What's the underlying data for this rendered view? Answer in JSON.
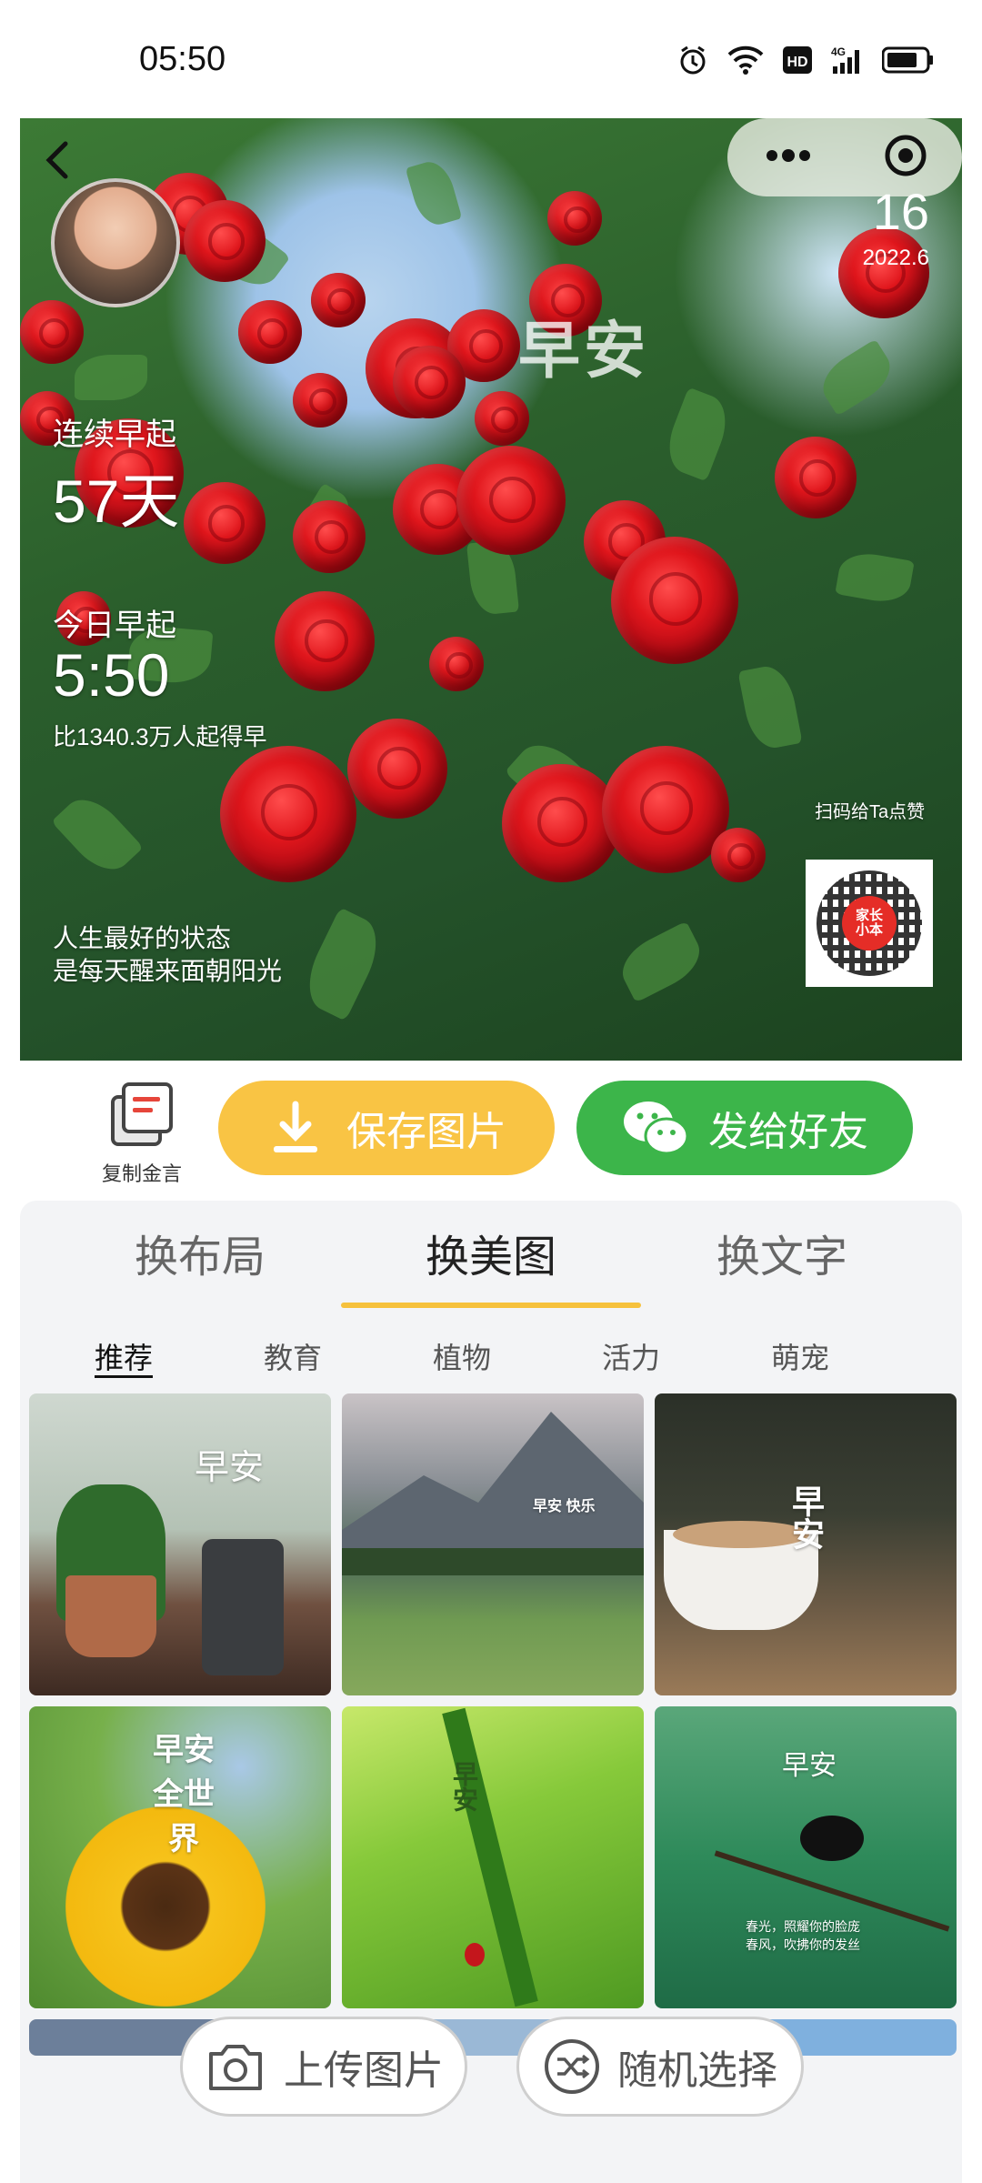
{
  "status_bar": {
    "time": "05:50",
    "icons": [
      "alarm-icon",
      "wifi-icon",
      "hd-icon",
      "4g-signal-icon",
      "battery-icon"
    ]
  },
  "hero": {
    "capsule_icons": [
      "more-dots-icon",
      "close-target-icon"
    ],
    "day": "16",
    "date": "2022.6",
    "greeting": "早安",
    "streak_label": "连续早起",
    "streak_value": "57天",
    "today_label": "今日早起",
    "today_time": "5:50",
    "rank_text": "比1340.3万人起得早",
    "scan_text": "扫码给Ta点赞",
    "quote_line1": "人生最好的状态",
    "quote_line2": "是每天醒来面朝阳光",
    "qr_logo_text": "家长\n小本"
  },
  "actions": {
    "copy_label": "复制金言",
    "save_label": "保存图片",
    "send_label": "发给好友"
  },
  "tabs": [
    {
      "label": "换布局",
      "active": false
    },
    {
      "label": "换美图",
      "active": true
    },
    {
      "label": "换文字",
      "active": false
    }
  ],
  "categories": [
    {
      "label": "推荐",
      "active": true
    },
    {
      "label": "教育",
      "active": false
    },
    {
      "label": "植物",
      "active": false
    },
    {
      "label": "活力",
      "active": false
    },
    {
      "label": "萌宠",
      "active": false
    }
  ],
  "thumbnails": [
    {
      "name": "potted-plant",
      "title": "早安"
    },
    {
      "name": "mountain-meadow",
      "title": "早安 快乐"
    },
    {
      "name": "coffee-cup",
      "title": "早安"
    },
    {
      "name": "sunflower",
      "title": "早安 全世界"
    },
    {
      "name": "green-grass",
      "title": "早安"
    },
    {
      "name": "magpie-branch",
      "title": "早安",
      "caption1": "春光，照耀你的脸庞",
      "caption2": "春风，吹拂你的发丝"
    }
  ],
  "bottom_buttons": {
    "upload_label": "上传图片",
    "random_label": "随机选择"
  },
  "colors": {
    "save_button": "#f9c444",
    "send_button": "#3cb54a",
    "tab_underline": "#f6c13c",
    "rose_red": "#e0161c"
  }
}
